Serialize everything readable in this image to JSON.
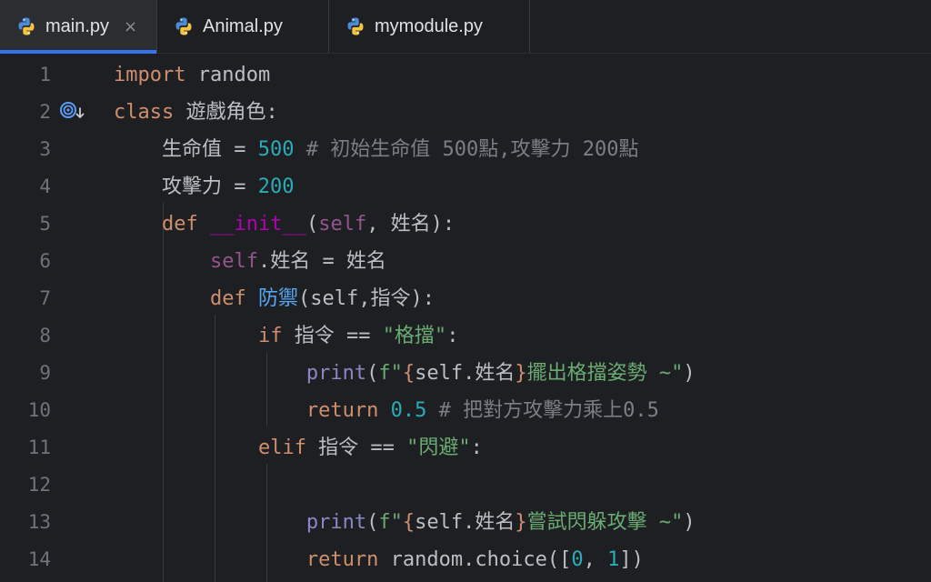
{
  "tabs": [
    {
      "label": "main.py",
      "active": true,
      "closable": true,
      "close_glyph": "×"
    },
    {
      "label": "Animal.py",
      "active": false
    },
    {
      "label": "mymodule.py",
      "active": false
    }
  ],
  "colors": {
    "background": "#1e1f22",
    "keyword": "#cf8e6d",
    "number": "#2aacb8",
    "comment": "#7a7e85",
    "string": "#6aab73",
    "self": "#94558d",
    "accent": "#3574f0"
  },
  "gutter": {
    "icon": "implemented-override-icon",
    "line": 2
  },
  "code": {
    "line_numbers": [
      "1",
      "2",
      "3",
      "4",
      "5",
      "6",
      "7",
      "8",
      "9",
      "10",
      "11",
      "12",
      "13",
      "14"
    ],
    "l1": {
      "kw": "import",
      "rest": " random"
    },
    "l2": {
      "kw": "class",
      "rest": " 遊戲角色:"
    },
    "l3": {
      "indent": "    ",
      "name": "生命值",
      "op": " = ",
      "num": "500",
      "comment": " # 初始生命值 500點,攻擊力 200點"
    },
    "l4": {
      "indent": "    ",
      "name": "攻擊力",
      "op": " = ",
      "num": "200"
    },
    "l5": {
      "indent": "    ",
      "kw": "def",
      "sp": " ",
      "fn": "__init__",
      "p1": "(",
      "self": "self",
      "p2": ", 姓名):"
    },
    "l6": {
      "indent": "        ",
      "self": "self",
      "rest": ".姓名 = 姓名"
    },
    "l7": {
      "indent": "        ",
      "kw": "def",
      "sp": " ",
      "fn": "防禦",
      "rest": "(self,指令):"
    },
    "l8": {
      "indent": "            ",
      "kw": "if",
      "rest": " 指令 == ",
      "str": "\"格擋\"",
      "end": ":"
    },
    "l9": {
      "indent": "                ",
      "builtin": "print",
      "p": "(",
      "str1": "f\"",
      "b1": "{",
      "expr": "self.姓名",
      "b2": "}",
      "str2": "擺出格擋姿勢 ~\"",
      "end": ")"
    },
    "l10": {
      "indent": "                ",
      "kw": "return",
      "sp": " ",
      "num": "0.5",
      "comment": " # 把對方攻擊力乘上0.5"
    },
    "l11": {
      "indent": "            ",
      "kw": "elif",
      "rest": " 指令 == ",
      "str": "\"閃避\"",
      "end": ":"
    },
    "l12": {
      "text": ""
    },
    "l13": {
      "indent": "                ",
      "builtin": "print",
      "p": "(",
      "str1": "f\"",
      "b1": "{",
      "expr": "self.姓名",
      "b2": "}",
      "str2": "嘗試閃躲攻擊 ~\"",
      "end": ")"
    },
    "l14": {
      "indent": "                ",
      "kw": "return",
      "rest": " random.choice([",
      "n0": "0",
      "comma": ", ",
      "n1": "1",
      "end": "])"
    }
  }
}
